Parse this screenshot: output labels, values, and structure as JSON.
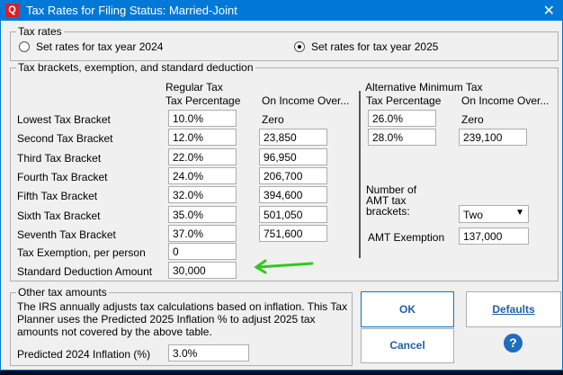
{
  "window": {
    "title": "Tax Rates for Filing Status: Married-Joint",
    "close": "✕",
    "logo": "Q"
  },
  "tax_rates": {
    "legend": "Tax rates",
    "option_2024": "Set rates for tax year 2024",
    "option_2025": "Set rates for tax year 2025",
    "selected": "2025"
  },
  "brackets": {
    "legend": "Tax brackets, exemption, and standard deduction",
    "regular_header": "Regular Tax",
    "pct_header": "Tax Percentage",
    "income_header": "On Income Over...",
    "amt_header": "Alternative Minimum Tax",
    "amt_pct_header": "Tax Percentage",
    "amt_income_header": "On Income Over...",
    "rows": [
      {
        "label": "Lowest Tax Bracket",
        "pct": "10.0%",
        "income": "Zero"
      },
      {
        "label": "Second Tax Bracket",
        "pct": "12.0%",
        "income": "23,850"
      },
      {
        "label": "Third Tax Bracket",
        "pct": "22.0%",
        "income": "96,950"
      },
      {
        "label": "Fourth Tax Bracket",
        "pct": "24.0%",
        "income": "206,700"
      },
      {
        "label": "Fifth Tax Bracket",
        "pct": "32.0%",
        "income": "394,600"
      },
      {
        "label": "Sixth Tax Bracket",
        "pct": "35.0%",
        "income": "501,050"
      },
      {
        "label": "Seventh Tax Bracket",
        "pct": "37.0%",
        "income": "751,600"
      }
    ],
    "exemption_label": "Tax Exemption, per person",
    "exemption": "0",
    "deduction_label": "Standard Deduction Amount",
    "deduction": "30,000",
    "amt_rows": [
      {
        "pct": "26.0%",
        "income": "Zero"
      },
      {
        "pct": "28.0%",
        "income": "239,100"
      }
    ],
    "amt_count_label": "Number of\nAMT tax\nbrackets:",
    "amt_count": "Two",
    "amt_exemption_label": "AMT Exemption",
    "amt_exemption": "137,000"
  },
  "other": {
    "legend": "Other tax amounts",
    "description": "The IRS annually adjusts tax calculations based on inflation.  This Tax Planner uses the Predicted 2025 Inflation % to adjust 2025 tax amounts not covered by the above table.",
    "inflation_label": "Predicted 2024 Inflation (%)",
    "inflation": "3.0%"
  },
  "buttons": {
    "ok": "OK",
    "defaults": "Defaults",
    "cancel": "Cancel",
    "help": "?"
  },
  "annotation_color": "#2ecc1a"
}
